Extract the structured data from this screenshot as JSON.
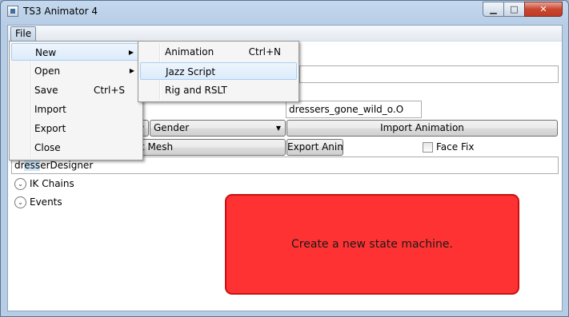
{
  "window": {
    "title": "TS3 Animator 4",
    "min_glyph": "▁",
    "max_glyph": "□",
    "close_glyph": "✕"
  },
  "menubar": {
    "file": "File"
  },
  "file_menu": [
    {
      "label": "New",
      "shortcut": "",
      "submenu_arrow": "▶"
    },
    {
      "label": "Open",
      "shortcut": "",
      "submenu_arrow": "▶"
    },
    {
      "label": "Save",
      "shortcut": "Ctrl+S",
      "submenu_arrow": ""
    },
    {
      "label": "Import",
      "shortcut": "",
      "submenu_arrow": ""
    },
    {
      "label": "Export",
      "shortcut": "",
      "submenu_arrow": ""
    },
    {
      "label": "Close",
      "shortcut": "",
      "submenu_arrow": ""
    }
  ],
  "new_submenu": [
    {
      "label": "Animation",
      "shortcut": "Ctrl+N"
    },
    {
      "label": "Jazz Script",
      "shortcut": ""
    },
    {
      "label": "Rig and RSLT",
      "shortcut": ""
    }
  ],
  "form": {
    "top_field_value": "",
    "name_field_value": "dressers_gone_wild_o.O",
    "gender_combo": "Gender",
    "combo_arrow": "▼",
    "import_animation_button": "Import Animation",
    "import_mesh_button_visible": "rt Mesh",
    "export_anim_button": "Export Anim",
    "face_fix_label": "Face Fix",
    "face_fix_checked": false,
    "designer_prefix": "dr",
    "designer_selected": "ess",
    "designer_suffix": "erDesigner"
  },
  "expanders": [
    {
      "label": "IK Chains",
      "glyph": "⌄"
    },
    {
      "label": "Events",
      "glyph": "⌄"
    }
  ],
  "message_box": {
    "text": "Create a new state machine."
  }
}
